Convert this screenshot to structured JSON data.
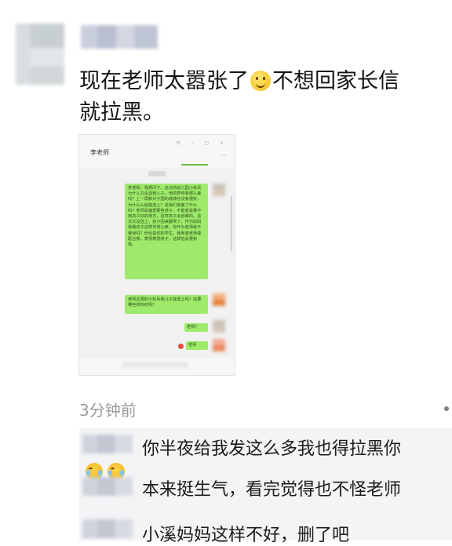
{
  "post": {
    "line1": "现在老师太嚣张了",
    "line1b": "不想回家长信",
    "line2": "就拉黑。",
    "emoji": "smile-emoji",
    "time_ago": "3分钟前"
  },
  "screenshot": {
    "chat_title": "李老师",
    "window_controls": "⊡ – □ ×",
    "more": "···",
    "messages": [
      "李老师，我想问下，这次的幼儿园小标兵为什么又没选我儿子，他的表现有那么差吗？上一周和对子园的成绩也没有很好，为什么么就能选上？是我们家差了什么吗？老师是偏爱那些孩子，不能老是看不到孩子好的地方，这样孩子会自卑的。这次又没选上，孩子回来都哭了，作为妈妈我看孩子这样非常心疼，你作为老师就不难受吗？他也是你的学生，我希望老师能配合我，表扬表扬孩子，这样他会更积极。",
      "老师这周的小标兵我儿子能选上吗？还要哪些资料的吗？",
      "老师？",
      "老师"
    ]
  },
  "comments": [
    {
      "text": "你半夜给我发这么多我也得拉黑你"
    },
    {
      "text": "本来挺生气，看完觉得也不怪老师"
    },
    {
      "text": "小溪妈妈这样不好，删了吧"
    }
  ],
  "colors": {
    "bubble_green": "#9eea6a",
    "reply_bg": "#f4f4f6",
    "meta_gray": "#9c9c9c"
  }
}
